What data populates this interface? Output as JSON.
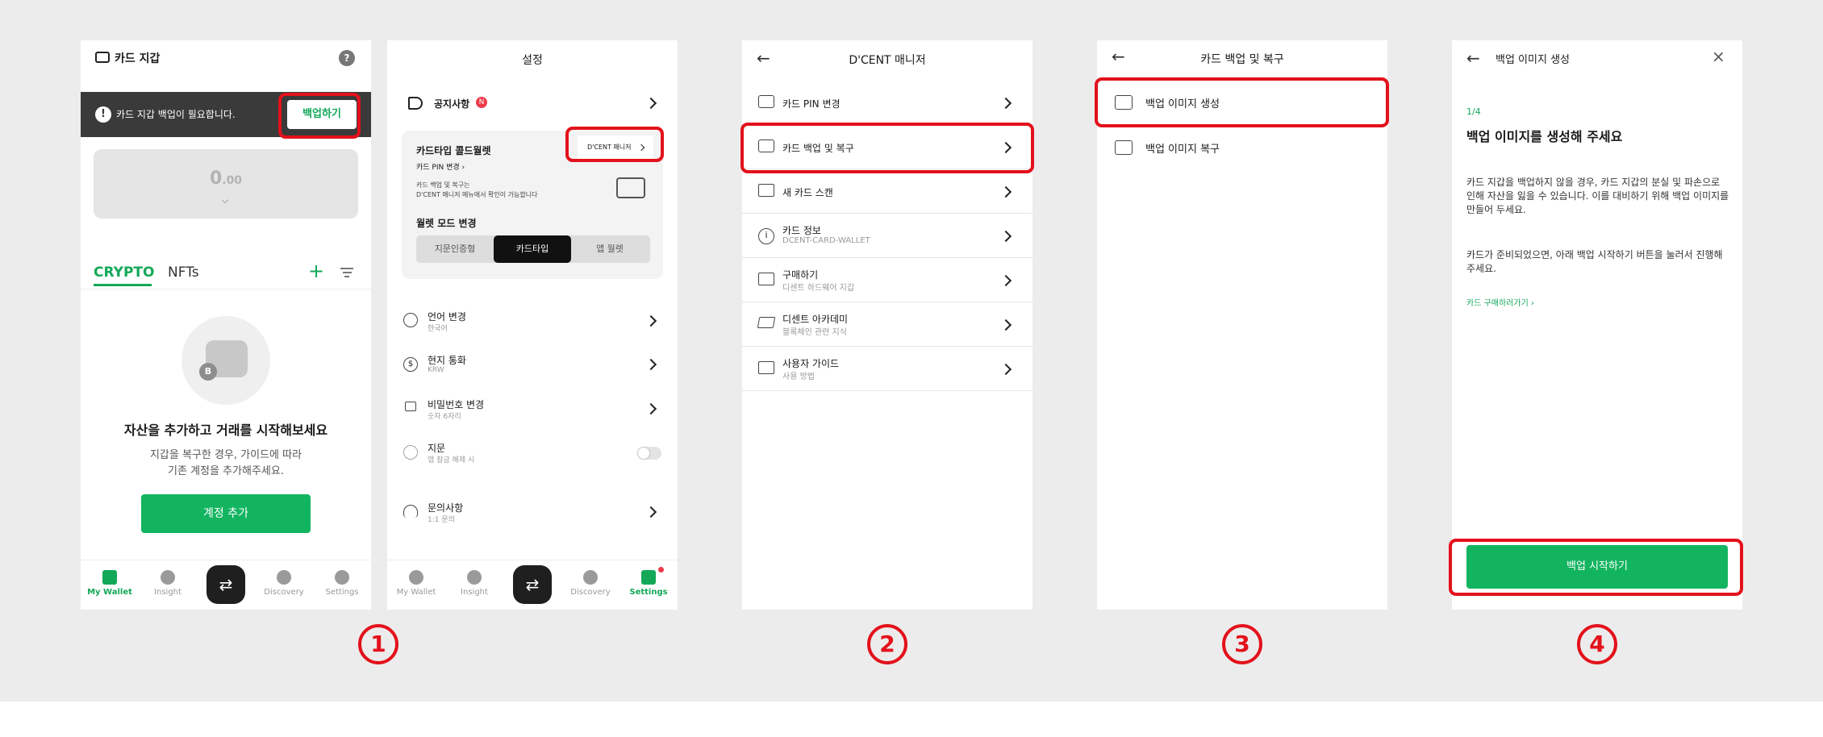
{
  "s1": {
    "title": "카드 지갑",
    "help": "?",
    "banner_text": "카드 지갑 백업이 필요합니다.",
    "banner_button": "백업하기",
    "balance_main": "0",
    "balance_dec": ".00",
    "tab_crypto": "CRYPTO",
    "tab_nfts": "NFTs",
    "empty_title": "자산을 추가하고 거래를 시작해보세요",
    "empty_desc1": "지갑을 복구한 경우, 가이드에 따라",
    "empty_desc2": "기존 계정을 추가해주세요.",
    "add_account": "계정 추가",
    "tabs": [
      "My Wallet",
      "Insight",
      "Discovery",
      "Settings"
    ],
    "accent": "#13b460"
  },
  "s2": {
    "title": "설정",
    "notice": "공지사항",
    "notice_badge": "N",
    "card_title": "카드타입 콜드월렛",
    "card_pin": "카드 PIN 변경",
    "card_note1": "카드 백업 및 복구는",
    "card_note2": "D'CENT 매니저 메뉴에서 확인이 가능합니다",
    "manager_btn": "D'CENT 매니저",
    "wallet_mode": "월렛 모드 변경",
    "modes": [
      "지문인증형",
      "카드타입",
      "앱 월렛"
    ],
    "items": [
      {
        "label": "언어 변경",
        "sub": "한국어"
      },
      {
        "label": "현지 통화",
        "sub": "KRW"
      },
      {
        "label": "비밀번호 변경",
        "sub": "숫자 6자리"
      },
      {
        "label": "지문",
        "sub": "앱 잠금 해제 시"
      },
      {
        "label": "문의사항",
        "sub": "1:1 문의"
      }
    ],
    "tabs": [
      "My Wallet",
      "Insight",
      "Discovery",
      "Settings"
    ]
  },
  "s3": {
    "title": "D'CENT 매니저",
    "items": [
      {
        "label": "카드 PIN 변경",
        "sub": ""
      },
      {
        "label": "카드 백업 및 복구",
        "sub": ""
      },
      {
        "label": "새 카드 스캔",
        "sub": ""
      },
      {
        "label": "카드 정보",
        "sub": "DCENT-CARD-WALLET"
      },
      {
        "label": "구매하기",
        "sub": "디센트 하드웨어 지갑"
      },
      {
        "label": "디센트 아카데미",
        "sub": "블록체인 관련 지식"
      },
      {
        "label": "사용자 가이드",
        "sub": "사용 방법"
      }
    ]
  },
  "s4": {
    "title": "카드 백업 및 복구",
    "items": [
      "백업 이미지 생성",
      "백업 이미지 복구"
    ]
  },
  "s5": {
    "title": "백업 이미지 생성",
    "step": "1/4",
    "heading": "백업 이미지를 생성해 주세요",
    "para1": "카드 지갑을 백업하지 않을 경우, 카드 지갑의 분실 및 파손으로 인해 자산을 잃을 수 있습니다. 이를 대비하기 위해 백업 이미지를 만들어 두세요.",
    "para2": "카드가 준비되었으면, 아래 백업 시작하기 버튼을 눌러서 진행해주세요.",
    "link": "카드 구매하러가기",
    "start": "백업 시작하기"
  },
  "steps": [
    "1",
    "2",
    "3",
    "4"
  ]
}
